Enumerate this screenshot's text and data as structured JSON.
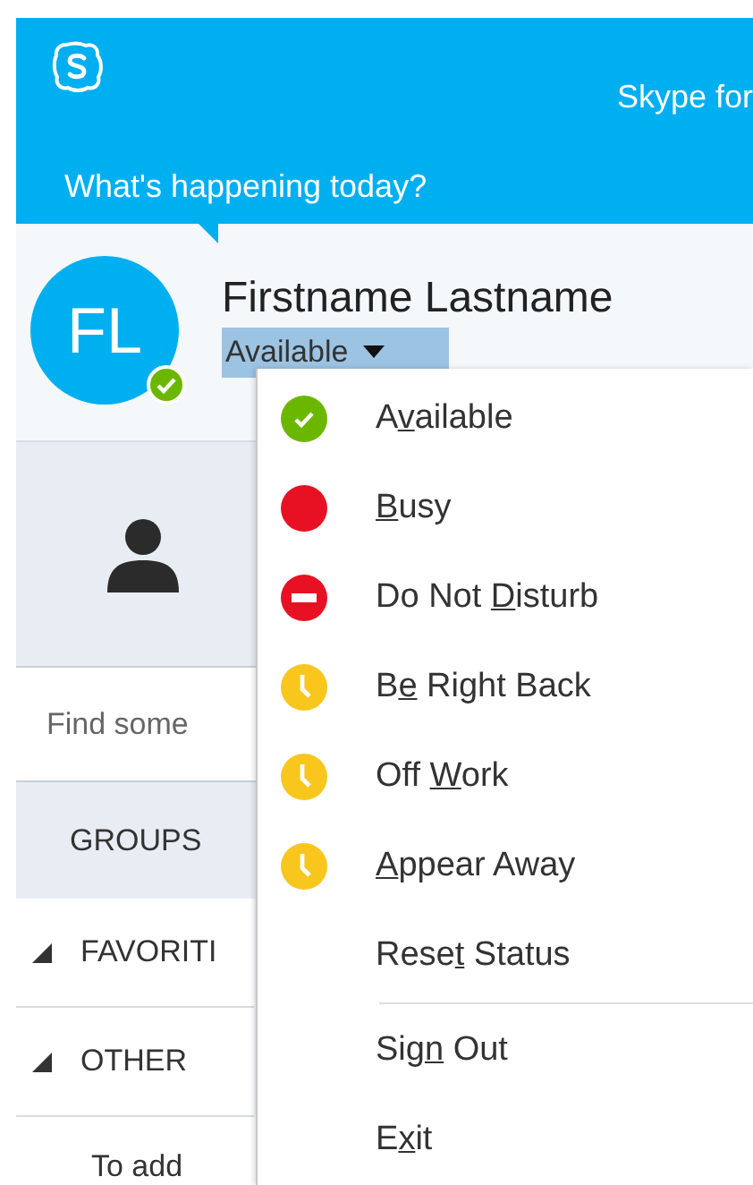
{
  "header": {
    "app_title": "Skype for",
    "prompt": "What's happening today?"
  },
  "profile": {
    "initials": "FL",
    "name": "Firstname Lastname",
    "status": "Available"
  },
  "search": {
    "placeholder": "Find some"
  },
  "groups_tab": "GROUPS",
  "groups": [
    {
      "label": "FAVORITI",
      "expanded": true
    },
    {
      "label": "OTHER",
      "expanded": true
    }
  ],
  "hint": "To add",
  "status_menu": {
    "items": [
      {
        "kind": "available",
        "color": "#6bb700",
        "before": "A",
        "key": "v",
        "after": "ailable",
        "divider_above": false
      },
      {
        "kind": "busy",
        "color": "#e81123",
        "key": "B",
        "after": "usy",
        "divider_above": false
      },
      {
        "kind": "dnd",
        "color": "#e81123",
        "before": "Do Not ",
        "key": "D",
        "after": "isturb",
        "divider_above": false
      },
      {
        "kind": "away",
        "color": "#f8c61d",
        "before": "B",
        "key": "e",
        "after": " Right Back",
        "divider_above": false
      },
      {
        "kind": "away",
        "color": "#f8c61d",
        "before": "Off ",
        "key": "W",
        "after": "ork",
        "divider_above": false
      },
      {
        "kind": "away",
        "color": "#f8c61d",
        "key": "A",
        "after": "ppear Away",
        "divider_above": false
      },
      {
        "kind": "plain",
        "before": "Rese",
        "key": "t",
        "after": " Status",
        "divider_above": false
      },
      {
        "kind": "plain",
        "before": "Sig",
        "key": "n",
        "after": " Out",
        "divider_above": true
      },
      {
        "kind": "plain",
        "before": "E",
        "key": "x",
        "after": "it",
        "divider_above": false
      }
    ]
  }
}
